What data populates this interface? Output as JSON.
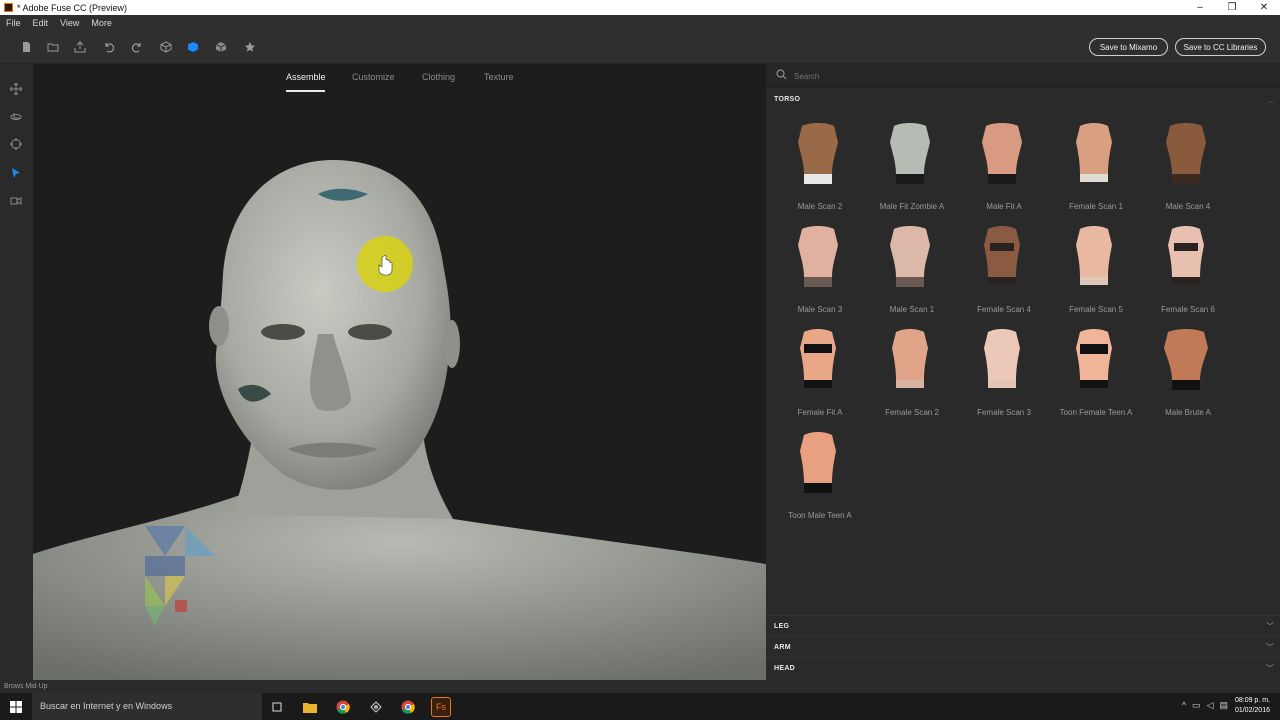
{
  "window": {
    "title": "* Adobe Fuse CC (Preview)",
    "controls": {
      "minimize": "–",
      "restore": "❐",
      "close": "✕"
    }
  },
  "menu": [
    "File",
    "Edit",
    "View",
    "More"
  ],
  "toolbar": {
    "save_mixamo": "Save to Mixamo",
    "save_cc": "Save to CC Libraries",
    "accent": "#1a8cff"
  },
  "viewport": {
    "tabs": [
      "Assemble",
      "Customize",
      "Clothing",
      "Texture"
    ],
    "active_tab": "Assemble"
  },
  "panel": {
    "search_placeholder": "Search",
    "section": "TORSO",
    "items": [
      "Male Scan 2",
      "Male Fit Zombie A",
      "Male Fit A",
      "Female Scan 1",
      "Male Scan 4",
      "Male Scan 3",
      "Male Scan 1",
      "Female Scan 4",
      "Female Scan 5",
      "Female Scan 6",
      "Female Fit A",
      "Female Scan 2",
      "Female Scan 3",
      "Toon Female Teen A",
      "Male Brute A",
      "Toon Male Teen A"
    ],
    "collapsed_sections": [
      "LEG",
      "ARM",
      "HEAD"
    ]
  },
  "status": {
    "text": "Brows Mid Up"
  },
  "taskbar": {
    "search_text": "Buscar en Internet y en Windows",
    "time": "08:09 p. m.",
    "date": "01/02/2016"
  }
}
